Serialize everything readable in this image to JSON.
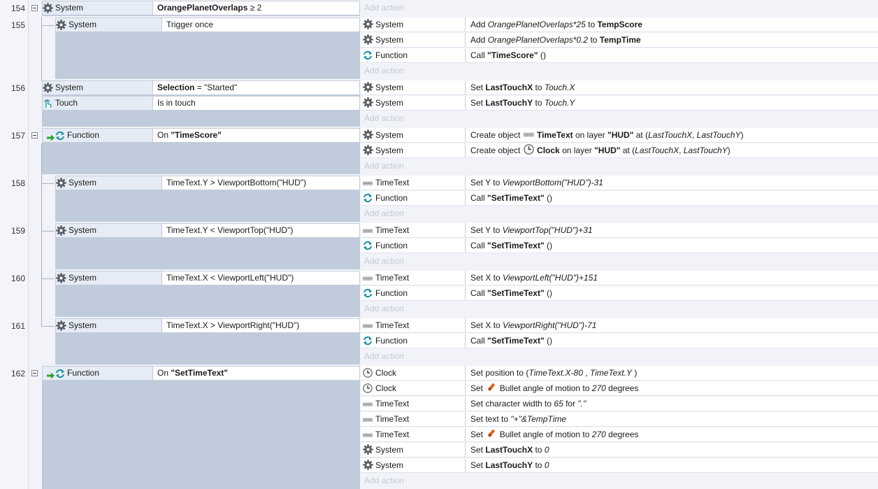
{
  "events": [
    {
      "num": "154",
      "conditions": [
        {
          "object": "System",
          "icon": "gear-icon",
          "parts": [
            {
              "t": "OrangePlanetOverlaps",
              "s": "b"
            },
            {
              "t": " ≥ 2",
              "s": ""
            }
          ]
        }
      ],
      "actions": [],
      "add_action": "Add action"
    },
    {
      "num": "155",
      "conditions": [
        {
          "object": "System",
          "icon": "gear-icon",
          "parts": [
            {
              "t": "Trigger once",
              "s": ""
            }
          ]
        }
      ],
      "actions": [
        {
          "object": "System",
          "icon": "gear-icon",
          "parts": [
            {
              "t": "Add ",
              "s": ""
            },
            {
              "t": "OrangePlanetOverlaps*25",
              "s": "i"
            },
            {
              "t": " to ",
              "s": ""
            },
            {
              "t": "TempScore",
              "s": "b"
            }
          ]
        },
        {
          "object": "System",
          "icon": "gear-icon",
          "parts": [
            {
              "t": "Add ",
              "s": ""
            },
            {
              "t": "OrangePlanetOverlaps*0.2",
              "s": "i"
            },
            {
              "t": "  to ",
              "s": ""
            },
            {
              "t": "TempTime",
              "s": "b"
            }
          ]
        },
        {
          "object": "Function",
          "icon": "function-icon",
          "parts": [
            {
              "t": "Call ",
              "s": ""
            },
            {
              "t": "\"TimeScore\"",
              "s": "b"
            },
            {
              "t": " ()",
              "s": ""
            }
          ]
        }
      ],
      "add_action": "Add action"
    },
    {
      "num": "156",
      "conditions": [
        {
          "object": "System",
          "icon": "gear-icon",
          "parts": [
            {
              "t": "Selection",
              "s": "b"
            },
            {
              "t": " = \"Started\"",
              "s": ""
            }
          ]
        },
        {
          "object": "Touch",
          "icon": "touch-icon",
          "parts": [
            {
              "t": "Is in touch",
              "s": ""
            }
          ]
        }
      ],
      "actions": [
        {
          "object": "System",
          "icon": "gear-icon",
          "parts": [
            {
              "t": "Set ",
              "s": ""
            },
            {
              "t": "LastTouchX",
              "s": "b"
            },
            {
              "t": " to ",
              "s": ""
            },
            {
              "t": "Touch.X",
              "s": "i"
            }
          ]
        },
        {
          "object": "System",
          "icon": "gear-icon",
          "parts": [
            {
              "t": "Set ",
              "s": ""
            },
            {
              "t": "LastTouchY",
              "s": "b"
            },
            {
              "t": " to ",
              "s": ""
            },
            {
              "t": "Touch.Y",
              "s": "i"
            }
          ]
        }
      ],
      "add_action": "Add action"
    },
    {
      "num": "157",
      "conditions": [
        {
          "object": "Function",
          "icon": "function-icon",
          "trigger": true,
          "parts": [
            {
              "t": "On ",
              "s": ""
            },
            {
              "t": "\"TimeScore\"",
              "s": "b"
            }
          ]
        }
      ],
      "actions": [
        {
          "object": "System",
          "icon": "gear-icon",
          "parts": [
            {
              "t": "Create object ",
              "s": ""
            },
            {
              "t": "",
              "s": "icon:text-object-icon"
            },
            {
              "t": " TimeText",
              "s": "b"
            },
            {
              "t": " on layer ",
              "s": ""
            },
            {
              "t": "\"HUD\"",
              "s": "b"
            },
            {
              "t": " at (",
              "s": ""
            },
            {
              "t": "LastTouchX",
              "s": "i"
            },
            {
              "t": ", ",
              "s": ""
            },
            {
              "t": "LastTouchY",
              "s": "i"
            },
            {
              "t": ")",
              "s": ""
            }
          ]
        },
        {
          "object": "System",
          "icon": "gear-icon",
          "parts": [
            {
              "t": "Create object ",
              "s": ""
            },
            {
              "t": "",
              "s": "icon:clock-icon"
            },
            {
              "t": " Clock",
              "s": "b"
            },
            {
              "t": " on layer ",
              "s": ""
            },
            {
              "t": "\"HUD\"",
              "s": "b"
            },
            {
              "t": " at (",
              "s": ""
            },
            {
              "t": "LastTouchX",
              "s": "i"
            },
            {
              "t": ", ",
              "s": ""
            },
            {
              "t": "LastTouchY",
              "s": "i"
            },
            {
              "t": ")",
              "s": ""
            }
          ]
        }
      ],
      "add_action": "Add action"
    },
    {
      "num": "158",
      "conditions": [
        {
          "object": "System",
          "icon": "gear-icon",
          "parts": [
            {
              "t": "TimeText.Y > ViewportBottom(\"HUD\")",
              "s": ""
            }
          ]
        }
      ],
      "actions": [
        {
          "object": "TimeText",
          "icon": "text-object-icon",
          "parts": [
            {
              "t": "Set Y to ",
              "s": ""
            },
            {
              "t": "ViewportBottom(\"HUD\")-31",
              "s": "i"
            }
          ]
        },
        {
          "object": "Function",
          "icon": "function-icon",
          "parts": [
            {
              "t": "Call ",
              "s": ""
            },
            {
              "t": "\"SetTimeText\"",
              "s": "b"
            },
            {
              "t": " ()",
              "s": ""
            }
          ]
        }
      ],
      "add_action": "Add action"
    },
    {
      "num": "159",
      "conditions": [
        {
          "object": "System",
          "icon": "gear-icon",
          "parts": [
            {
              "t": "TimeText.Y < ViewportTop(\"HUD\")",
              "s": ""
            }
          ]
        }
      ],
      "actions": [
        {
          "object": "TimeText",
          "icon": "text-object-icon",
          "parts": [
            {
              "t": "Set Y to ",
              "s": ""
            },
            {
              "t": "ViewportTop(\"HUD\")+31",
              "s": "i"
            }
          ]
        },
        {
          "object": "Function",
          "icon": "function-icon",
          "parts": [
            {
              "t": "Call ",
              "s": ""
            },
            {
              "t": "\"SetTimeText\"",
              "s": "b"
            },
            {
              "t": " ()",
              "s": ""
            }
          ]
        }
      ],
      "add_action": "Add action"
    },
    {
      "num": "160",
      "conditions": [
        {
          "object": "System",
          "icon": "gear-icon",
          "parts": [
            {
              "t": "TimeText.X < ViewportLeft(\"HUD\")",
              "s": ""
            }
          ]
        }
      ],
      "actions": [
        {
          "object": "TimeText",
          "icon": "text-object-icon",
          "parts": [
            {
              "t": "Set X to ",
              "s": ""
            },
            {
              "t": "ViewportLeft(\"HUD\")+151",
              "s": "i"
            }
          ]
        },
        {
          "object": "Function",
          "icon": "function-icon",
          "parts": [
            {
              "t": "Call ",
              "s": ""
            },
            {
              "t": "\"SetTimeText\"",
              "s": "b"
            },
            {
              "t": " ()",
              "s": ""
            }
          ]
        }
      ],
      "add_action": "Add action"
    },
    {
      "num": "161",
      "conditions": [
        {
          "object": "System",
          "icon": "gear-icon",
          "parts": [
            {
              "t": "TimeText.X > ViewportRight(\"HUD\")",
              "s": ""
            }
          ]
        }
      ],
      "actions": [
        {
          "object": "TimeText",
          "icon": "text-object-icon",
          "parts": [
            {
              "t": "Set X to ",
              "s": ""
            },
            {
              "t": "ViewportRight(\"HUD\")-71",
              "s": "i"
            }
          ]
        },
        {
          "object": "Function",
          "icon": "function-icon",
          "parts": [
            {
              "t": "Call ",
              "s": ""
            },
            {
              "t": "\"SetTimeText\"",
              "s": "b"
            },
            {
              "t": " ()",
              "s": ""
            }
          ]
        }
      ],
      "add_action": "Add action"
    },
    {
      "num": "162",
      "conditions": [
        {
          "object": "Function",
          "icon": "function-icon",
          "trigger": true,
          "parts": [
            {
              "t": "On ",
              "s": ""
            },
            {
              "t": "\"SetTimeText\"",
              "s": "b"
            }
          ]
        }
      ],
      "actions": [
        {
          "object": "Clock",
          "icon": "clock-icon",
          "parts": [
            {
              "t": "Set position to (",
              "s": ""
            },
            {
              "t": "TimeText.X-80",
              "s": "i"
            },
            {
              "t": " , ",
              "s": ""
            },
            {
              "t": "TimeText.Y",
              "s": "i"
            },
            {
              "t": " )",
              "s": ""
            }
          ]
        },
        {
          "object": "Clock",
          "icon": "clock-icon",
          "parts": [
            {
              "t": "Set ",
              "s": ""
            },
            {
              "t": "",
              "s": "icon:bullet-icon"
            },
            {
              "t": " Bullet angle of motion to ",
              "s": ""
            },
            {
              "t": "270",
              "s": "i"
            },
            {
              "t": " degrees",
              "s": ""
            }
          ]
        },
        {
          "object": "TimeText",
          "icon": "text-object-icon",
          "parts": [
            {
              "t": "Set character width to ",
              "s": ""
            },
            {
              "t": "65",
              "s": "i"
            },
            {
              "t": " for ",
              "s": ""
            },
            {
              "t": "\".\"",
              "s": "i"
            }
          ]
        },
        {
          "object": "TimeText",
          "icon": "text-object-icon",
          "parts": [
            {
              "t": "Set text to ",
              "s": ""
            },
            {
              "t": "\"+\"&TempTime",
              "s": "i"
            }
          ]
        },
        {
          "object": "TimeText",
          "icon": "text-object-icon",
          "parts": [
            {
              "t": "Set ",
              "s": ""
            },
            {
              "t": "",
              "s": "icon:bullet-icon"
            },
            {
              "t": " Bullet angle of motion to ",
              "s": ""
            },
            {
              "t": "270",
              "s": "i"
            },
            {
              "t": " degrees",
              "s": ""
            }
          ]
        },
        {
          "object": "System",
          "icon": "gear-icon",
          "parts": [
            {
              "t": "Set ",
              "s": ""
            },
            {
              "t": "LastTouchX",
              "s": "b"
            },
            {
              "t": " to ",
              "s": ""
            },
            {
              "t": "0",
              "s": "i"
            }
          ]
        },
        {
          "object": "System",
          "icon": "gear-icon",
          "parts": [
            {
              "t": "Set ",
              "s": ""
            },
            {
              "t": "LastTouchY",
              "s": "b"
            },
            {
              "t": " to ",
              "s": ""
            },
            {
              "t": "0",
              "s": "i"
            }
          ]
        }
      ],
      "add_action": "Add action"
    }
  ],
  "colors": {
    "gear": "#5a5f66",
    "function": "#1f8ea3",
    "trigger_arrow": "#2aa52a",
    "clock": "#7a7a7a",
    "bullet": "#d9652a"
  }
}
